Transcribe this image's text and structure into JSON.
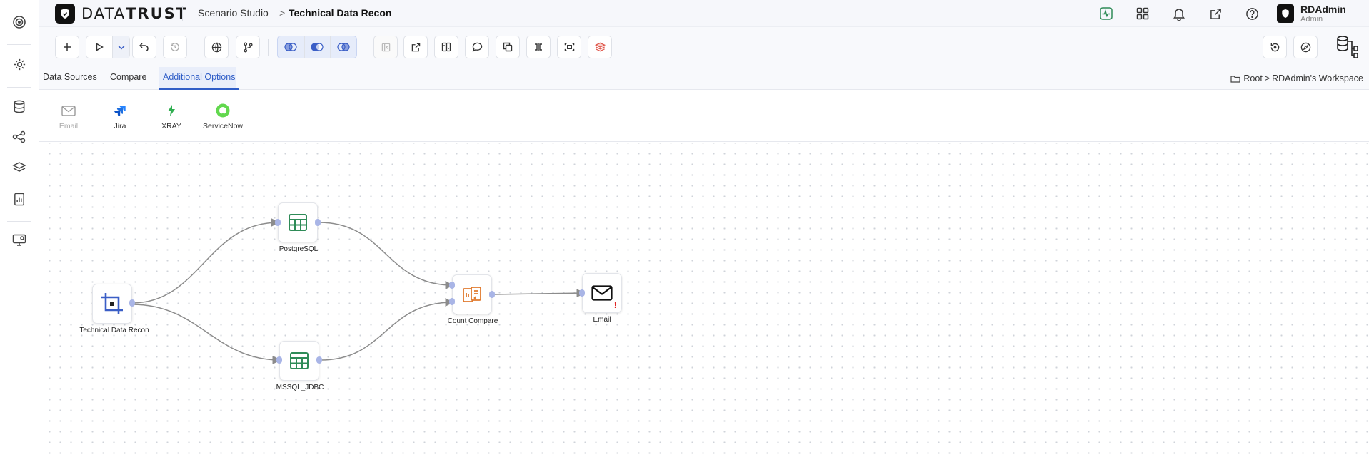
{
  "header": {
    "brand_a": "DATA",
    "brand_b": "TRUST",
    "breadcrumb_app": "Scenario Studio",
    "breadcrumb_sep": ">",
    "breadcrumb_page": "Technical Data Recon",
    "icons": [
      "activity-icon",
      "apps-grid-icon",
      "bell-icon",
      "external-link-icon",
      "help-icon"
    ],
    "user_name": "RDAdmin",
    "user_role": "Admin"
  },
  "toolbar": {
    "buttons": [
      "add-icon",
      "run-icon",
      "run-options-chevron-icon",
      "undo-icon",
      "history-icon",
      "globe-icon",
      "branch-icon",
      "join-left-icon",
      "join-inner-icon",
      "join-right-icon",
      "collapse-panel-icon",
      "open-external-icon",
      "compare-icon",
      "comment-icon",
      "copy-icon",
      "split-icon",
      "fit-view-icon",
      "layers-icon",
      "restore-icon",
      "compass-icon",
      "database-tree-icon"
    ]
  },
  "tabs": [
    {
      "label": "Data Sources",
      "active": false
    },
    {
      "label": "Compare",
      "active": false
    },
    {
      "label": "Additional Options",
      "active": true
    }
  ],
  "workspace": {
    "root": "Root",
    "sep": ">",
    "name": "RDAdmin's Workspace"
  },
  "palette": [
    {
      "label": "Email",
      "icon": "mail-icon",
      "disabled": true
    },
    {
      "label": "Jira",
      "icon": "jira-icon",
      "disabled": false
    },
    {
      "label": "XRAY",
      "icon": "xray-bolt-icon",
      "disabled": false
    },
    {
      "label": "ServiceNow",
      "icon": "servicenow-icon",
      "disabled": false
    }
  ],
  "nodes": {
    "source": {
      "label": "Technical Data Recon",
      "icon": "crop-frame-icon"
    },
    "pg": {
      "label": "PostgreSQL",
      "icon": "table-grid-icon"
    },
    "mssql": {
      "label": "MSSQL_JDBC",
      "icon": "table-grid-icon"
    },
    "count": {
      "label": "Count Compare",
      "icon": "count-compare-icon"
    },
    "email": {
      "label": "Email",
      "icon": "mail-icon",
      "warning": "!"
    }
  },
  "colors": {
    "accent": "#2f5dc7",
    "green": "#2e8b57",
    "orange": "#e07a2e",
    "jira": "#2684ff",
    "warning": "#e02424"
  }
}
